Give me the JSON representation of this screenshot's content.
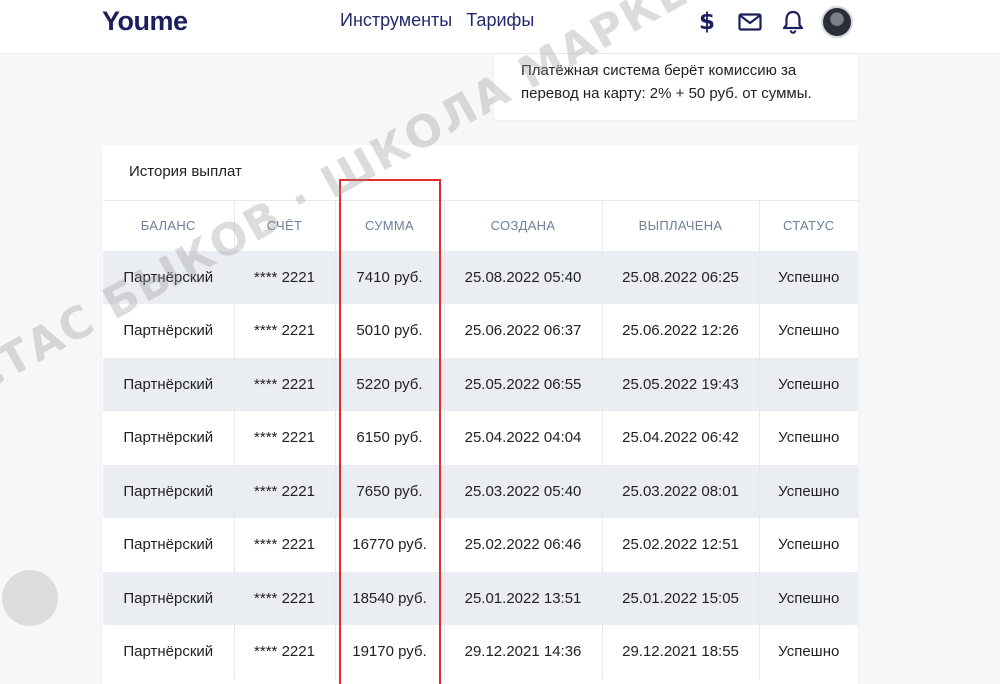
{
  "header": {
    "logo": "Youme",
    "nav": [
      "Инструменты",
      "Тарифы"
    ],
    "icons": [
      "dollar-icon",
      "mail-icon",
      "bell-icon",
      "avatar"
    ],
    "dollar_glyph": "$"
  },
  "note": {
    "text": "Платёжная система берёт комиссию за перевод на карту: 2% + 50 руб. от суммы."
  },
  "history": {
    "title": "История выплат",
    "columns": [
      "БАЛАНС",
      "СЧЁТ",
      "СУММА",
      "СОЗДАНА",
      "ВЫПЛАЧЕНА",
      "СТАТУС"
    ],
    "rows": [
      [
        "Партнёрский",
        "**** 2221",
        "7410 руб.",
        "25.08.2022 05:40",
        "25.08.2022 06:25",
        "Успешно"
      ],
      [
        "Партнёрский",
        "**** 2221",
        "5010 руб.",
        "25.06.2022 06:37",
        "25.06.2022 12:26",
        "Успешно"
      ],
      [
        "Партнёрский",
        "**** 2221",
        "5220 руб.",
        "25.05.2022 06:55",
        "25.05.2022 19:43",
        "Успешно"
      ],
      [
        "Партнёрский",
        "**** 2221",
        "6150 руб.",
        "25.04.2022 04:04",
        "25.04.2022 06:42",
        "Успешно"
      ],
      [
        "Партнёрский",
        "**** 2221",
        "7650 руб.",
        "25.03.2022 05:40",
        "25.03.2022 08:01",
        "Успешно"
      ],
      [
        "Партнёрский",
        "**** 2221",
        "16770 руб.",
        "25.02.2022 06:46",
        "25.02.2022 12:51",
        "Успешно"
      ],
      [
        "Партнёрский",
        "**** 2221",
        "18540 руб.",
        "25.01.2022 13:51",
        "25.01.2022 15:05",
        "Успешно"
      ],
      [
        "Партнёрский",
        "**** 2221",
        "19170 руб.",
        "29.12.2021 14:36",
        "29.12.2021 18:55",
        "Успешно"
      ]
    ]
  },
  "watermark": "СТАС БЫКОВ · ШКОЛА МАРКЕТОЛОГОВ · ЗНАНИЯ - ДЕНЬГИ!",
  "colors": {
    "brand": "#1c1f5e",
    "highlight": "#e42b2b",
    "row_stripe": "#eaedf2",
    "header_text": "#6f7e9a"
  }
}
